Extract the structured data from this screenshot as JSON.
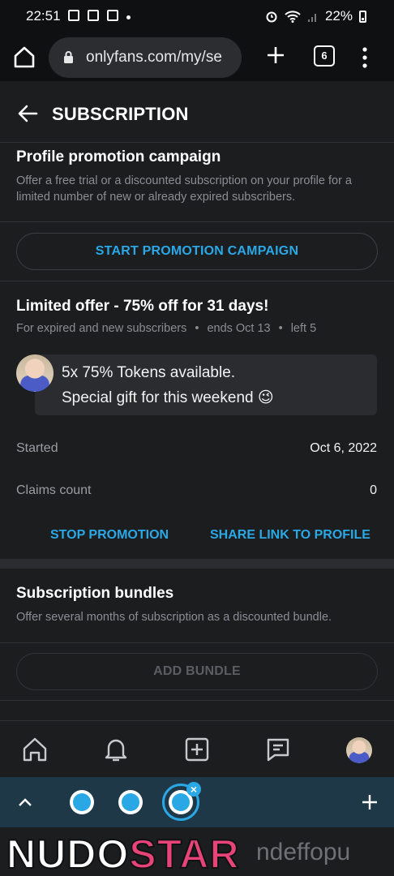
{
  "status_bar": {
    "time": "22:51",
    "battery": "22%"
  },
  "browser": {
    "url": "onlyfans.com/my/se",
    "tab_count": "6"
  },
  "header": {
    "title": "SUBSCRIPTION"
  },
  "promotion": {
    "title": "Profile promotion campaign",
    "description": "Offer a free trial or a discounted subscription on your profile for a limited number of new or already expired subscribers.",
    "start_button": "START PROMOTION CAMPAIGN"
  },
  "offer": {
    "title": "Limited offer - 75% off for 31 days!",
    "audience": "For expired and new subscribers",
    "ends": "ends Oct 13",
    "left": "left 5",
    "message_line1": "5x 75% Tokens available.",
    "message_line2": "Special gift for this weekend 😉",
    "started_label": "Started",
    "started_value": "Oct 6, 2022",
    "claims_label": "Claims count",
    "claims_value": "0",
    "stop_button": "STOP PROMOTION",
    "share_button": "SHARE LINK TO PROFILE"
  },
  "bundles": {
    "title": "Subscription bundles",
    "description": "Offer several months of subscription as a discounted bundle.",
    "add_button": "ADD BUNDLE"
  },
  "watermark": {
    "brand_a": "NUDO",
    "brand_b": "STAR",
    "tail": "ndeffopu"
  },
  "colors": {
    "accent": "#2aa8e6",
    "background": "#1b1d1f",
    "brand": "#e8447a"
  }
}
